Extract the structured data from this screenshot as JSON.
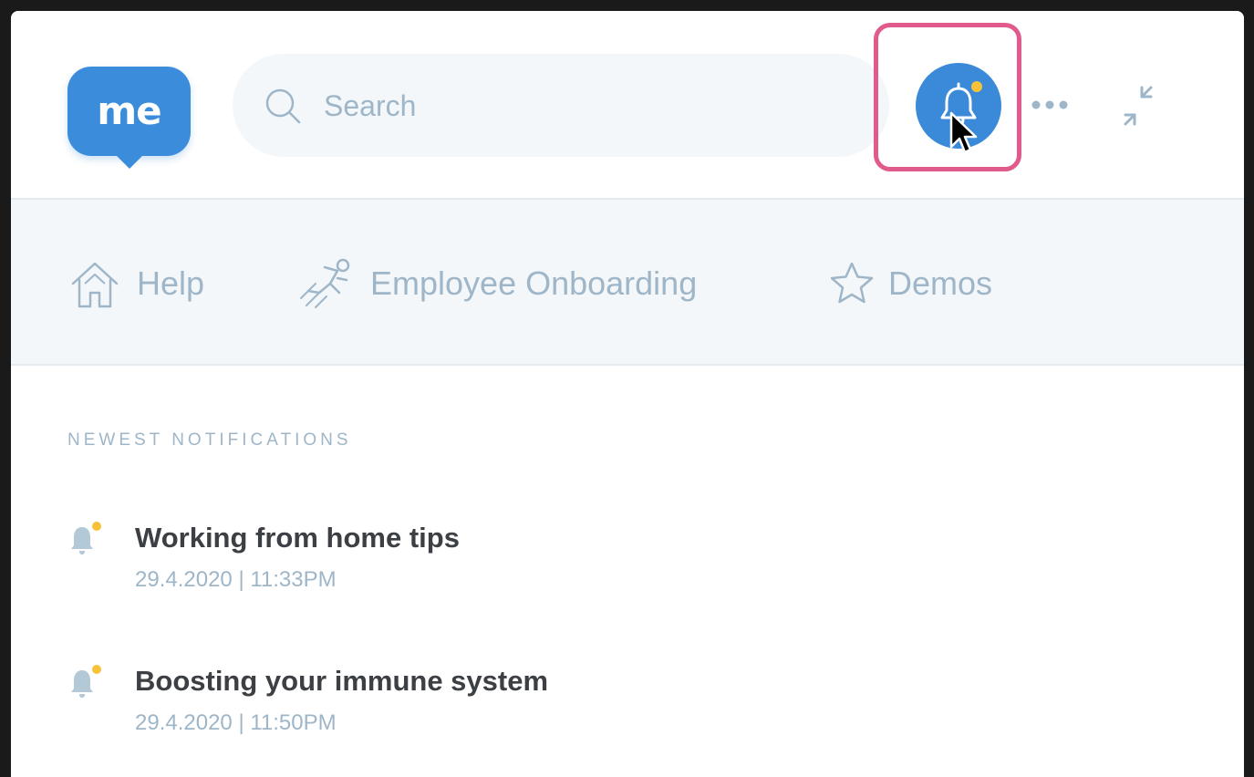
{
  "logo": {
    "text": "me",
    "icon": "me-logo"
  },
  "search": {
    "placeholder": "Search",
    "icon": "search-icon"
  },
  "toolbar": {
    "notifications_icon": "bell-icon",
    "has_unread": true,
    "more_icon": "ellipsis-icon",
    "collapse_icon": "collapse-icon"
  },
  "nav": {
    "items": [
      {
        "label": "Help",
        "icon": "home-icon"
      },
      {
        "label": "Employee Onboarding",
        "icon": "runner-icon"
      },
      {
        "label": "Demos",
        "icon": "star-icon"
      }
    ]
  },
  "notifications": {
    "section_title": "NEWEST NOTIFICATIONS",
    "items": [
      {
        "title": "Working from home tips",
        "time": "29.4.2020 | 11:33PM"
      },
      {
        "title": "Boosting your immune system",
        "time": "29.4.2020 | 11:50PM"
      }
    ]
  },
  "colors": {
    "brand": "#3b8ddb",
    "highlight": "#e05a8b",
    "unread_dot": "#f7c238",
    "muted": "#9eb6c8",
    "text": "#3c3f43"
  }
}
